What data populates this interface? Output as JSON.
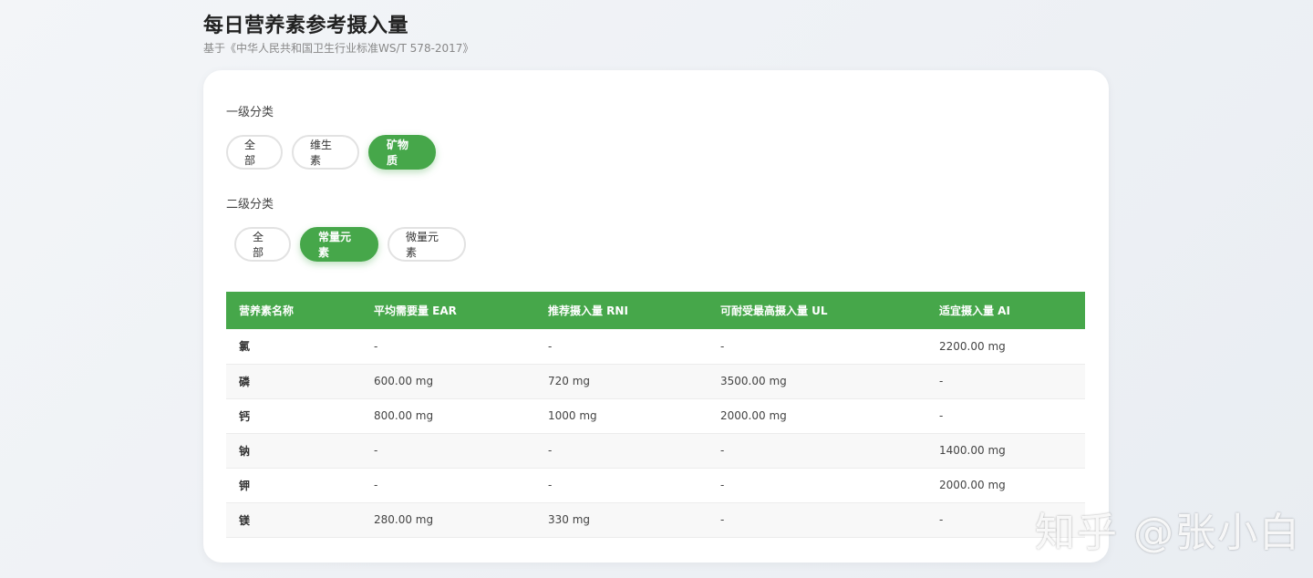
{
  "header": {
    "title": "每日营养素参考摄入量",
    "subtitle": "基于《中华人民共和国卫生行业标准WS/T 578-2017》"
  },
  "filters": {
    "primary_label": "一级分类",
    "primary": [
      {
        "label": "全部",
        "active": false
      },
      {
        "label": "维生素",
        "active": false
      },
      {
        "label": "矿物质",
        "active": true
      }
    ],
    "secondary_label": "二级分类",
    "secondary": [
      {
        "label": "全部",
        "active": false
      },
      {
        "label": "常量元素",
        "active": true
      },
      {
        "label": "微量元素",
        "active": false
      }
    ]
  },
  "table": {
    "headers": [
      "营养素名称",
      "平均需要量 EAR",
      "推荐摄入量 RNI",
      "可耐受最高摄入量 UL",
      "适宜摄入量 AI"
    ],
    "rows": [
      [
        "氯",
        "-",
        "-",
        "-",
        "2200.00 mg"
      ],
      [
        "磷",
        "600.00 mg",
        "720 mg",
        "3500.00 mg",
        "-"
      ],
      [
        "钙",
        "800.00 mg",
        "1000 mg",
        "2000.00 mg",
        "-"
      ],
      [
        "钠",
        "-",
        "-",
        "-",
        "1400.00 mg"
      ],
      [
        "钾",
        "-",
        "-",
        "-",
        "2000.00 mg"
      ],
      [
        "镁",
        "280.00 mg",
        "330 mg",
        "-",
        "-"
      ]
    ]
  },
  "watermark": "知乎 @张小白",
  "colors": {
    "accent": "#46a74a"
  }
}
